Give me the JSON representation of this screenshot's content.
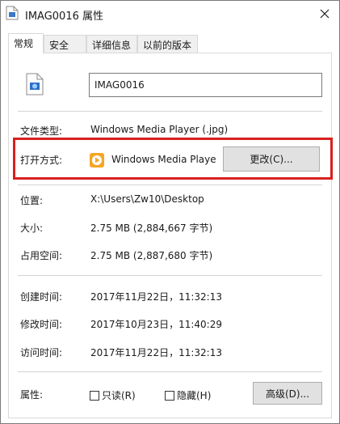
{
  "window": {
    "title": "IMAG0016 属性",
    "close_glyph": "✕"
  },
  "tabs": [
    "常规",
    "安全",
    "详细信息",
    "以前的版本"
  ],
  "general": {
    "file_name": "IMAG0016",
    "file_type": {
      "label": "文件类型:",
      "value": "Windows Media Player (.jpg)"
    },
    "open_with": {
      "label": "打开方式:",
      "value": "Windows Media Playe",
      "button": "更改(C)..."
    },
    "location": {
      "label": "位置:",
      "value": "X:\\Users\\Zw10\\Desktop"
    },
    "size": {
      "label": "大小:",
      "value": "2.75 MB (2,884,667 字节)"
    },
    "size_on_disk": {
      "label": "占用空间:",
      "value": "2.75 MB (2,887,680 字节)"
    },
    "created": {
      "label": "创建时间:",
      "value": "2017年11月22日，11:32:13"
    },
    "modified": {
      "label": "修改时间:",
      "value": "2017年10月23日，11:40:29"
    },
    "accessed": {
      "label": "访问时间:",
      "value": "2017年11月22日，11:32:13"
    },
    "attributes": {
      "label": "属性:",
      "readonly": {
        "label": "只读(R)",
        "checked": false
      },
      "hidden": {
        "label": "隐藏(H)",
        "checked": false
      },
      "advanced_button": "高级(D)..."
    }
  },
  "colors": {
    "highlight_border": "#d9201f",
    "app_icon": "#f5a623"
  }
}
